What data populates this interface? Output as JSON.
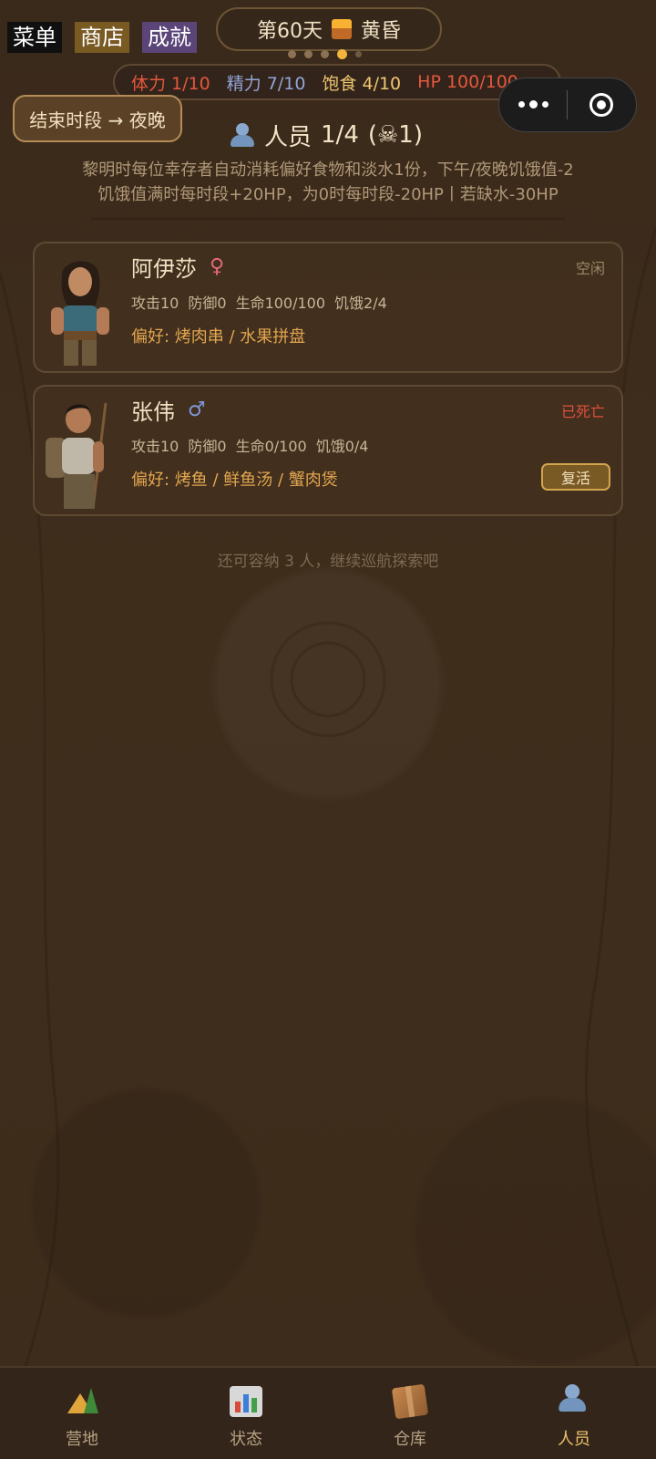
{
  "top_tags": {
    "menu": "菜单",
    "shop": "商店",
    "achievements": "成就"
  },
  "day": {
    "label": "第60天",
    "period": "黄昏",
    "page_dots": 5,
    "active_dot": 4
  },
  "stats": {
    "stamina": "体力 1/10",
    "energy": "精力 7/10",
    "satiety": "饱食 4/10",
    "hp": "HP 100/100"
  },
  "end_period_button": "结束时段 → 夜晚",
  "section": {
    "title": "人员",
    "count": "1/4",
    "dead_count": "(☠1)"
  },
  "description": {
    "line1": "黎明时每位幸存者自动消耗偏好食物和淡水1份，下午/夜晚饥饿值-2",
    "line2": "饥饿值满时每时段+20HP，为0时每时段-20HP丨若缺水-30HP"
  },
  "survivors": [
    {
      "name": "阿伊莎",
      "gender": "♀",
      "status": "空闲",
      "attack": "攻击10",
      "defense": "防御0",
      "life": "生命100/100",
      "hunger": "饥饿2/4",
      "preference": "偏好: 烤肉串 / 水果拼盘"
    },
    {
      "name": "张伟",
      "gender": "♂",
      "status": "已死亡",
      "attack": "攻击10",
      "defense": "防御0",
      "life": "生命0/100",
      "hunger": "饥饿0/4",
      "preference": "偏好: 烤鱼 / 鲜鱼汤 / 蟹肉煲",
      "action": "复活"
    }
  ],
  "capacity_note": "还可容纳 3 人，继续巡航探索吧",
  "tabs": [
    {
      "label": "营地",
      "icon": "camp-icon"
    },
    {
      "label": "状态",
      "icon": "chart-icon"
    },
    {
      "label": "仓库",
      "icon": "box-icon"
    },
    {
      "label": "人员",
      "icon": "people-icon",
      "active": true
    }
  ],
  "colors": {
    "accent": "#f0c46a",
    "danger": "#e0503c",
    "background": "#3f2d1c"
  }
}
